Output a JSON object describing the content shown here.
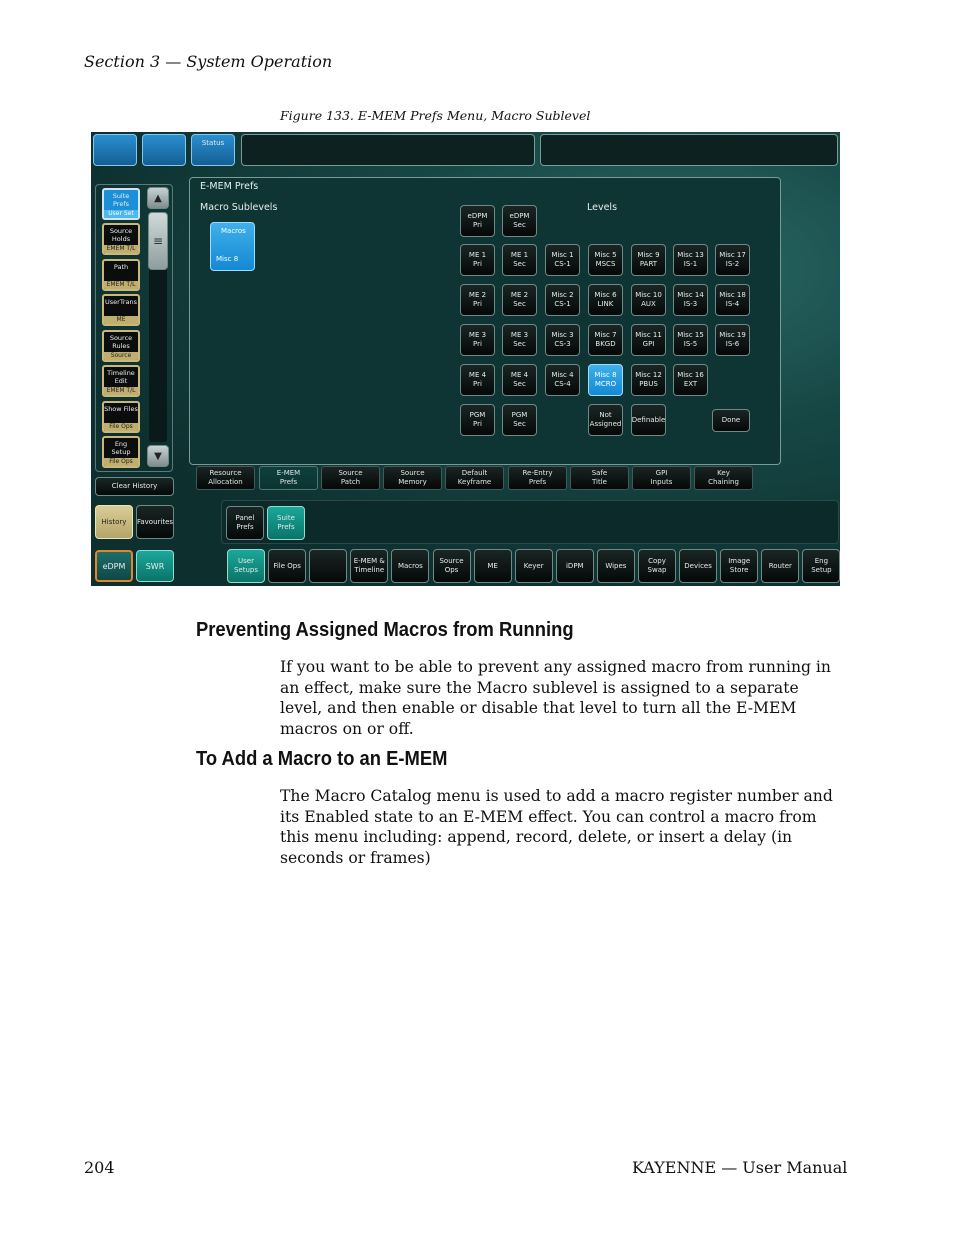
{
  "header": {
    "section": "Section 3 — System Operation"
  },
  "figure": {
    "caption": "Figure 133.  E-MEM Prefs Menu, Macro Sublevel"
  },
  "ui": {
    "top_status_label": "Status",
    "panel_title": "E-MEM Prefs",
    "macro_sublevels_label": "Macro Sublevels",
    "macro_button": {
      "line1": "Macros",
      "line2": "Misc 8"
    },
    "levels_label": "Levels",
    "levels_rows": [
      [
        {
          "l1": "eDPM",
          "l2": "Pri"
        },
        {
          "l1": "eDPM",
          "l2": "Sec"
        }
      ],
      [
        {
          "l1": "ME 1",
          "l2": "Pri"
        },
        {
          "l1": "ME 1",
          "l2": "Sec"
        },
        {
          "l1": "Misc 1",
          "l2": "CS-1"
        },
        {
          "l1": "Misc 5",
          "l2": "MSCS"
        },
        {
          "l1": "Misc 9",
          "l2": "PART"
        },
        {
          "l1": "Misc 13",
          "l2": "IS-1"
        },
        {
          "l1": "Misc 17",
          "l2": "IS-2"
        }
      ],
      [
        {
          "l1": "ME 2",
          "l2": "Pri"
        },
        {
          "l1": "ME 2",
          "l2": "Sec"
        },
        {
          "l1": "Misc 2",
          "l2": "CS-1"
        },
        {
          "l1": "Misc 6",
          "l2": "LINK"
        },
        {
          "l1": "Misc 10",
          "l2": "AUX"
        },
        {
          "l1": "Misc 14",
          "l2": "IS-3"
        },
        {
          "l1": "Misc 18",
          "l2": "IS-4"
        }
      ],
      [
        {
          "l1": "ME 3",
          "l2": "Pri"
        },
        {
          "l1": "ME 3",
          "l2": "Sec"
        },
        {
          "l1": "Misc 3",
          "l2": "CS-3"
        },
        {
          "l1": "Misc 7",
          "l2": "BKGD"
        },
        {
          "l1": "Misc 11",
          "l2": "GPI"
        },
        {
          "l1": "Misc 15",
          "l2": "IS-5"
        },
        {
          "l1": "Misc 19",
          "l2": "IS-6"
        }
      ],
      [
        {
          "l1": "ME 4",
          "l2": "Pri"
        },
        {
          "l1": "ME 4",
          "l2": "Sec"
        },
        {
          "l1": "Misc 4",
          "l2": "CS-4"
        },
        {
          "l1": "Misc 8",
          "l2": "MCRO"
        },
        {
          "l1": "Misc 12",
          "l2": "PBUS"
        },
        {
          "l1": "Misc 16",
          "l2": "EXT"
        }
      ],
      [
        {
          "l1": "PGM",
          "l2": "Pri"
        },
        {
          "l1": "PGM",
          "l2": "Sec"
        },
        {
          "l1": "Not",
          "l2": "Assigned"
        },
        {
          "l1": "Definable",
          "l2": ""
        },
        {
          "l1": "Done",
          "l2": ""
        }
      ]
    ],
    "sidebar": [
      {
        "main": "Suite\nPrefs",
        "sub": "User Set"
      },
      {
        "main": "Source\nHolds",
        "sub": "EMEM T/L"
      },
      {
        "main": "Path",
        "sub": "EMEM T/L"
      },
      {
        "main": "UserTrans",
        "sub": "ME"
      },
      {
        "main": "Source\nRules",
        "sub": "Source Ops"
      },
      {
        "main": "Timeline\nEdit",
        "sub": "EMEM T/L"
      },
      {
        "main": "Show Files",
        "sub": "File Ops"
      },
      {
        "main": "Eng\nSetup",
        "sub": "File Ops"
      }
    ],
    "clear_history": "Clear History",
    "history": "History",
    "favourites": "Favourites",
    "tabs": [
      {
        "l1": "Resource",
        "l2": "Allocation"
      },
      {
        "l1": "E-MEM",
        "l2": "Prefs"
      },
      {
        "l1": "Source",
        "l2": "Patch"
      },
      {
        "l1": "Source",
        "l2": "Memory"
      },
      {
        "l1": "Default",
        "l2": "Keyframe"
      },
      {
        "l1": "Re-Entry",
        "l2": "Prefs"
      },
      {
        "l1": "Safe",
        "l2": "Title"
      },
      {
        "l1": "GPI",
        "l2": "Inputs"
      },
      {
        "l1": "Key",
        "l2": "Chaining"
      }
    ],
    "sub_panel_prefs": {
      "l1": "Panel",
      "l2": "Prefs"
    },
    "sub_suite_prefs": {
      "l1": "Suite",
      "l2": "Prefs"
    },
    "edpm": "eDPM",
    "swr": "SWR",
    "bottom_bar": [
      {
        "l1": "User",
        "l2": "Setups"
      },
      {
        "l1": "File Ops",
        "l2": ""
      },
      {
        "l1": "",
        "l2": ""
      },
      {
        "l1": "E-MEM &",
        "l2": "Timeline"
      },
      {
        "l1": "Macros",
        "l2": ""
      },
      {
        "l1": "Source",
        "l2": "Ops"
      },
      {
        "l1": "ME",
        "l2": ""
      },
      {
        "l1": "Keyer",
        "l2": ""
      },
      {
        "l1": "iDPM",
        "l2": ""
      },
      {
        "l1": "Wipes",
        "l2": ""
      },
      {
        "l1": "Copy",
        "l2": "Swap"
      },
      {
        "l1": "Devices",
        "l2": ""
      },
      {
        "l1": "Image",
        "l2": "Store"
      },
      {
        "l1": "Router",
        "l2": ""
      },
      {
        "l1": "Eng",
        "l2": "Setup"
      }
    ]
  },
  "sections": [
    {
      "heading": "Preventing Assigned Macros from Running",
      "body": "If you want to be able to prevent any assigned macro from running in an effect, make sure the Macro sublevel is assigned to a separate level, and then enable or disable that level to turn all the E-MEM macros on or off."
    },
    {
      "heading": "To Add a Macro to an E-MEM",
      "body": "The Macro Catalog menu is used to add a macro register number and its Enabled state to an E-MEM effect. You can control a macro from this menu including: append, record, delete, or insert a delay (in seconds or frames)"
    }
  ],
  "footer": {
    "page": "204",
    "title": "KAYENNE  —  User Manual"
  }
}
